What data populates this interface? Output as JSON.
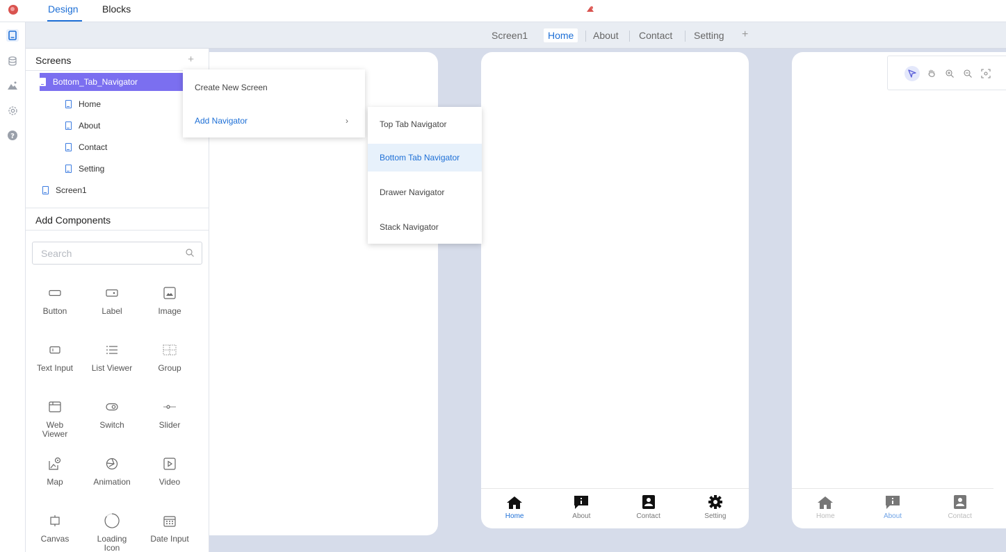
{
  "topbar": {
    "tabs": [
      "Design",
      "Blocks"
    ],
    "active_tab": "Design"
  },
  "screen_tabs": [
    "Screen1",
    "Home",
    "About",
    "Contact",
    "Setting"
  ],
  "screen_tabs_active": "Home",
  "screens_panel": {
    "title": "Screens",
    "navigator": "Bottom_Tab_Navigator",
    "children": [
      "Home",
      "About",
      "Contact",
      "Setting"
    ],
    "other": "Screen1"
  },
  "components_panel": {
    "title": "Add Components",
    "search_placeholder": "Search",
    "items": [
      "Button",
      "Label",
      "Image",
      "Text Input",
      "List Viewer",
      "Group",
      "Web Viewer",
      "Switch",
      "Slider",
      "Map",
      "Animation",
      "Video",
      "Canvas",
      "Loading Icon",
      "Date Input"
    ]
  },
  "context_menu": {
    "items": [
      "Create New Screen",
      "Add Navigator"
    ],
    "submenu": [
      "Top Tab Navigator",
      "Bottom Tab Navigator",
      "Drawer Navigator",
      "Stack Navigator"
    ],
    "submenu_highlight": "Bottom Tab Navigator"
  },
  "phone_home_tabs": [
    "Home",
    "About",
    "Contact",
    "Setting"
  ],
  "phone_about_tabs": [
    "Home",
    "About",
    "Contact"
  ],
  "colors": {
    "accent": "#1d6fd6",
    "selection": "#7b6ff0",
    "canvas_bg": "#d6dcea"
  }
}
